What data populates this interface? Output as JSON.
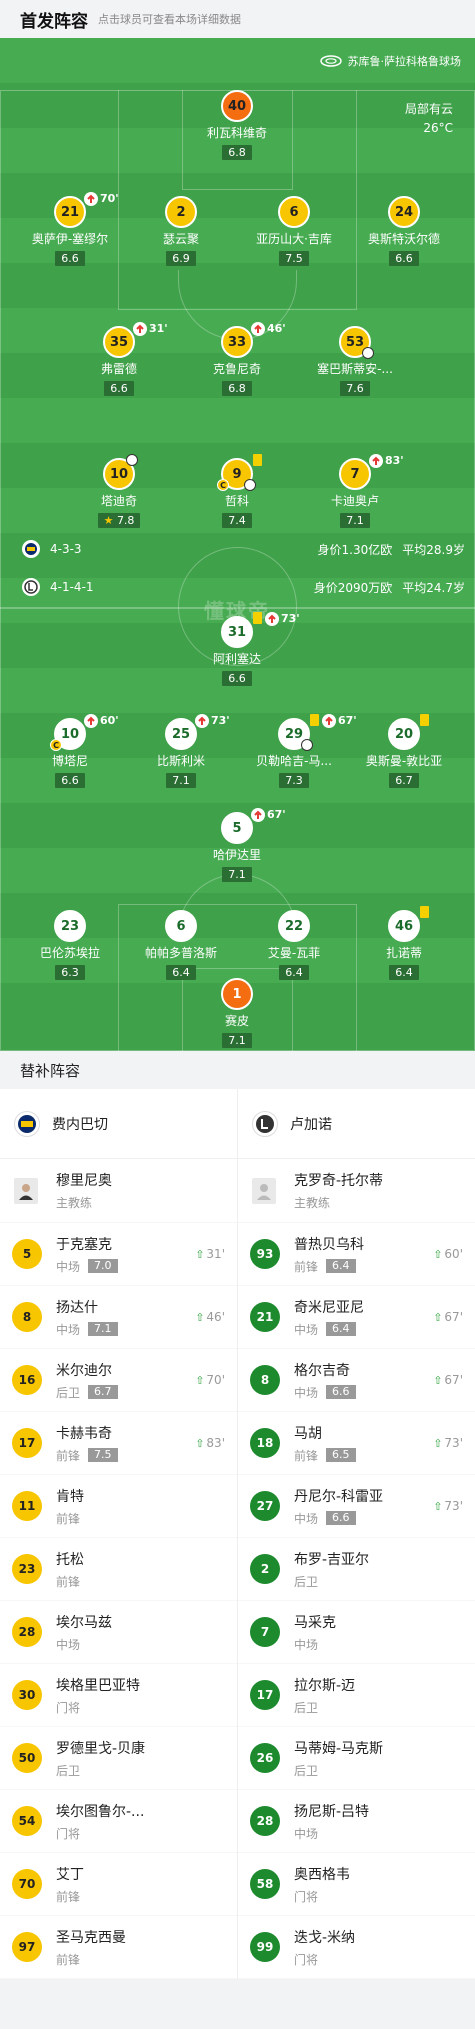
{
  "header": {
    "title": "首发阵容",
    "subtitle": "点击球员可查看本场详细数据"
  },
  "venue": "苏库鲁·萨拉科格鲁球场",
  "weather": {
    "sky": "局部有云",
    "temp": "26°C"
  },
  "watermark": "懂球帝",
  "home_team": {
    "formation": "4-3-3",
    "value": "身价1.30亿欧",
    "age": "平均28.9岁"
  },
  "away_team": {
    "formation": "4-1-4-1",
    "value": "身价2090万欧",
    "age": "平均24.7岁"
  },
  "home_players": [
    {
      "num": "40",
      "name": "利瓦科维奇",
      "rating": "6.8"
    },
    {
      "num": "21",
      "name": "奥萨伊-塞缪尔",
      "rating": "6.6",
      "sub": "70'"
    },
    {
      "num": "2",
      "name": "瑟云聚",
      "rating": "6.9"
    },
    {
      "num": "6",
      "name": "亚历山大·吉库",
      "rating": "7.5"
    },
    {
      "num": "24",
      "name": "奥斯特沃尔德",
      "rating": "6.6"
    },
    {
      "num": "35",
      "name": "弗雷德",
      "rating": "6.6",
      "sub": "31'"
    },
    {
      "num": "33",
      "name": "克鲁尼奇",
      "rating": "6.8",
      "sub": "46'"
    },
    {
      "num": "53",
      "name": "塞巴斯蒂安-...",
      "rating": "7.6"
    },
    {
      "num": "10",
      "name": "塔迪奇",
      "rating": "7.8"
    },
    {
      "num": "9",
      "name": "哲科",
      "rating": "7.4"
    },
    {
      "num": "7",
      "name": "卡迪奥卢",
      "rating": "7.1",
      "sub": "83'"
    }
  ],
  "away_players": [
    {
      "num": "31",
      "name": "阿利塞达",
      "rating": "6.6",
      "sub": "73'"
    },
    {
      "num": "10",
      "name": "博塔尼",
      "rating": "6.6",
      "sub": "60'"
    },
    {
      "num": "25",
      "name": "比斯利米",
      "rating": "7.1",
      "sub": "73'"
    },
    {
      "num": "29",
      "name": "贝勒哈吉-马...",
      "rating": "7.3",
      "sub": "67'"
    },
    {
      "num": "20",
      "name": "奥斯曼-敦比亚",
      "rating": "6.7"
    },
    {
      "num": "5",
      "name": "哈伊达里",
      "rating": "7.1",
      "sub": "67'"
    },
    {
      "num": "23",
      "name": "巴伦苏埃拉",
      "rating": "6.3"
    },
    {
      "num": "6",
      "name": "帕帕多普洛斯",
      "rating": "6.4"
    },
    {
      "num": "22",
      "name": "艾曼-瓦菲",
      "rating": "6.4"
    },
    {
      "num": "46",
      "name": "扎诺蒂",
      "rating": "6.4"
    },
    {
      "num": "1",
      "name": "赛皮",
      "rating": "7.1"
    }
  ],
  "subs_title": "替补阵容",
  "subs_home": {
    "team": "费内巴切",
    "coach": {
      "name": "穆里尼奥",
      "role": "主教练"
    },
    "players": [
      {
        "num": "5",
        "name": "于克塞克",
        "pos": "中场",
        "rating": "7.0",
        "time": "31'"
      },
      {
        "num": "8",
        "name": "扬达什",
        "pos": "中场",
        "rating": "7.1",
        "time": "46'"
      },
      {
        "num": "16",
        "name": "米尔迪尔",
        "pos": "后卫",
        "rating": "6.7",
        "time": "70'"
      },
      {
        "num": "17",
        "name": "卡赫韦奇",
        "pos": "前锋",
        "rating": "7.5",
        "time": "83'"
      },
      {
        "num": "11",
        "name": "肯特",
        "pos": "前锋"
      },
      {
        "num": "23",
        "name": "托松",
        "pos": "前锋"
      },
      {
        "num": "28",
        "name": "埃尔马兹",
        "pos": "中场"
      },
      {
        "num": "30",
        "name": "埃格里巴亚特",
        "pos": "门将"
      },
      {
        "num": "50",
        "name": "罗德里戈-贝康",
        "pos": "后卫"
      },
      {
        "num": "54",
        "name": "埃尔图鲁尔-...",
        "pos": "门将"
      },
      {
        "num": "70",
        "name": "艾丁",
        "pos": "前锋"
      },
      {
        "num": "97",
        "name": "圣马克西曼",
        "pos": "前锋"
      }
    ]
  },
  "subs_away": {
    "team": "卢加诺",
    "coach": {
      "name": "克罗奇-托尔蒂",
      "role": "主教练"
    },
    "players": [
      {
        "num": "93",
        "name": "普热贝乌科",
        "pos": "前锋",
        "rating": "6.4",
        "time": "60'"
      },
      {
        "num": "21",
        "name": "奇米尼亚尼",
        "pos": "中场",
        "rating": "6.4",
        "time": "67'"
      },
      {
        "num": "8",
        "name": "格尔吉奇",
        "pos": "中场",
        "rating": "6.6",
        "time": "67'"
      },
      {
        "num": "18",
        "name": "马胡",
        "pos": "前锋",
        "rating": "6.5",
        "time": "73'"
      },
      {
        "num": "27",
        "name": "丹尼尔-科雷亚",
        "pos": "中场",
        "rating": "6.6",
        "time": "73'"
      },
      {
        "num": "2",
        "name": "布罗-吉亚尔",
        "pos": "后卫"
      },
      {
        "num": "7",
        "name": "马采克",
        "pos": "中场"
      },
      {
        "num": "17",
        "name": "拉尔斯-迈",
        "pos": "后卫"
      },
      {
        "num": "26",
        "name": "马蒂姆-马克斯",
        "pos": "后卫"
      },
      {
        "num": "28",
        "name": "扬尼斯-吕特",
        "pos": "中场"
      },
      {
        "num": "58",
        "name": "奥西格韦",
        "pos": "门将"
      },
      {
        "num": "99",
        "name": "迭戈-米纳",
        "pos": "门将"
      }
    ]
  }
}
